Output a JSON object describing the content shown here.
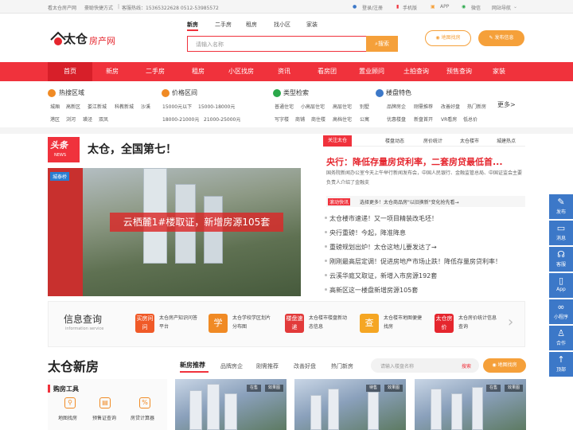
{
  "topbar": {
    "left_items": [
      "看太仓房产网",
      "豪聪快捷方式",
      "客服热线：15365322628 0512-53985572"
    ],
    "login": "登录/注册",
    "mobile": "手机版",
    "app": "APP",
    "wechat": "微信",
    "site_nav": "网站导航"
  },
  "header": {
    "logo_main": "太仓",
    "logo_sub": "房产网",
    "search_tabs": [
      "新房",
      "二手房",
      "租房",
      "找小区",
      "家装"
    ],
    "search_placeholder": "请输入名称",
    "search_button": "搜索",
    "map_button": "地图找房",
    "publish_button": "发布信息"
  },
  "nav": [
    "首页",
    "新房",
    "二手房",
    "租房",
    "小区找房",
    "资讯",
    "看房团",
    "置业顾问",
    "土拍查询",
    "预售查询",
    "家装"
  ],
  "filters": {
    "area": {
      "title": "热搜区域",
      "row1": [
        "城厢",
        "高新区",
        "娄江新城",
        "科教新城",
        "沙溪"
      ],
      "row2": [
        "港区",
        "浏河",
        "璜泾",
        "双凤"
      ]
    },
    "price": {
      "title": "价格区间",
      "row1": [
        "15000元以下",
        "15000-18000元"
      ],
      "row2": [
        "18000-21000元",
        "21000-25000元"
      ]
    },
    "type": {
      "title": "类型检索",
      "row1": [
        "普通住宅",
        "小高层住宅",
        "高层住宅",
        "别墅"
      ],
      "row2": [
        "写字楼",
        "商铺",
        "商住楼",
        "高档住宅",
        "公寓"
      ]
    },
    "feature": {
      "title": "楼盘特色",
      "row1": [
        "品牌房企",
        "刚需推荐",
        "改善好盘",
        "热门新房"
      ],
      "row2": [
        "优惠楼盘",
        "新盘首开",
        "VR看房",
        "低总价"
      ]
    },
    "more": "更多>"
  },
  "news": {
    "headline_badge": "头条",
    "headline_badge_sub": "NEWS",
    "headline": "太仓，全国第七！",
    "banner_tag": "城泰桥",
    "banner_text": "云栖麓1#楼取证，新增房源105套",
    "tabs": [
      "关注太仓",
      "楼盘动态",
      "房价统计",
      "太仓楼市",
      "城建热点"
    ],
    "top_title": "央行：降低存量房贷利率，二套房贷最低首...",
    "summary": "国务院新闻办公室今天上午举行新闻发布会，中国人民银行、金融监管总局、中国证监会主要负责人介绍了金融支",
    "flash_badge": "滚动快讯",
    "flash_text": "选择更多！太仓商品房\"以旧换新\"变化抢先看→",
    "list": [
      "太仓楼市速递！又一项目精装改毛坯！",
      "央行重磅！今起，降准降息",
      "重磅规划出炉！太仓这地儿要发达了→",
      "刚刚最高层定调！促进房地产市场止跌！降低存量房贷利率！",
      "云溪华庭又取证，新增入市房源192套",
      "高新区这一楼盘新增房源105套"
    ]
  },
  "info": {
    "title": "信息查询",
    "subtitle": "information service",
    "tools": [
      {
        "badge": "买房问问",
        "text": "太仓房产知识问答平台",
        "color": "#f05a28"
      },
      {
        "badge": "学",
        "text": "太仓学校学区划片分布图",
        "color": "#f08a24"
      },
      {
        "badge": "楼盘速递",
        "text": "太仓楼市楼盘新动态信息",
        "color": "#e23a3a"
      },
      {
        "badge": "查",
        "text": "太仓楼市地图便捷找房",
        "color": "#f5a623"
      },
      {
        "badge": "太仓房价",
        "text": "太仓房价统计信息查询",
        "color": "#e5262e"
      }
    ]
  },
  "newhouse": {
    "title": "太仓新房",
    "tabs": [
      "新房推荐",
      "品牌房企",
      "刚需推荐",
      "改善好盘",
      "热门新房"
    ],
    "search_placeholder": "请输入楼盘名称",
    "search_button": "搜索",
    "map_button": "地图找房",
    "purchase_tools": "购房工具",
    "tool_items": [
      "地图找房",
      "预售证查询",
      "房贷计算器"
    ],
    "tiles": [
      {
        "status": "在售",
        "tag": "效果图"
      },
      {
        "status": "待售",
        "tag": "效果图"
      },
      {
        "status": "在售",
        "tag": "效果图"
      }
    ]
  },
  "sidebar": [
    "发布",
    "消息",
    "客服",
    "App",
    "小程序",
    "合作",
    "顶部"
  ],
  "colors": {
    "brand": "#f0323c",
    "orange": "#f5a03a",
    "blue": "#3c78c8"
  }
}
